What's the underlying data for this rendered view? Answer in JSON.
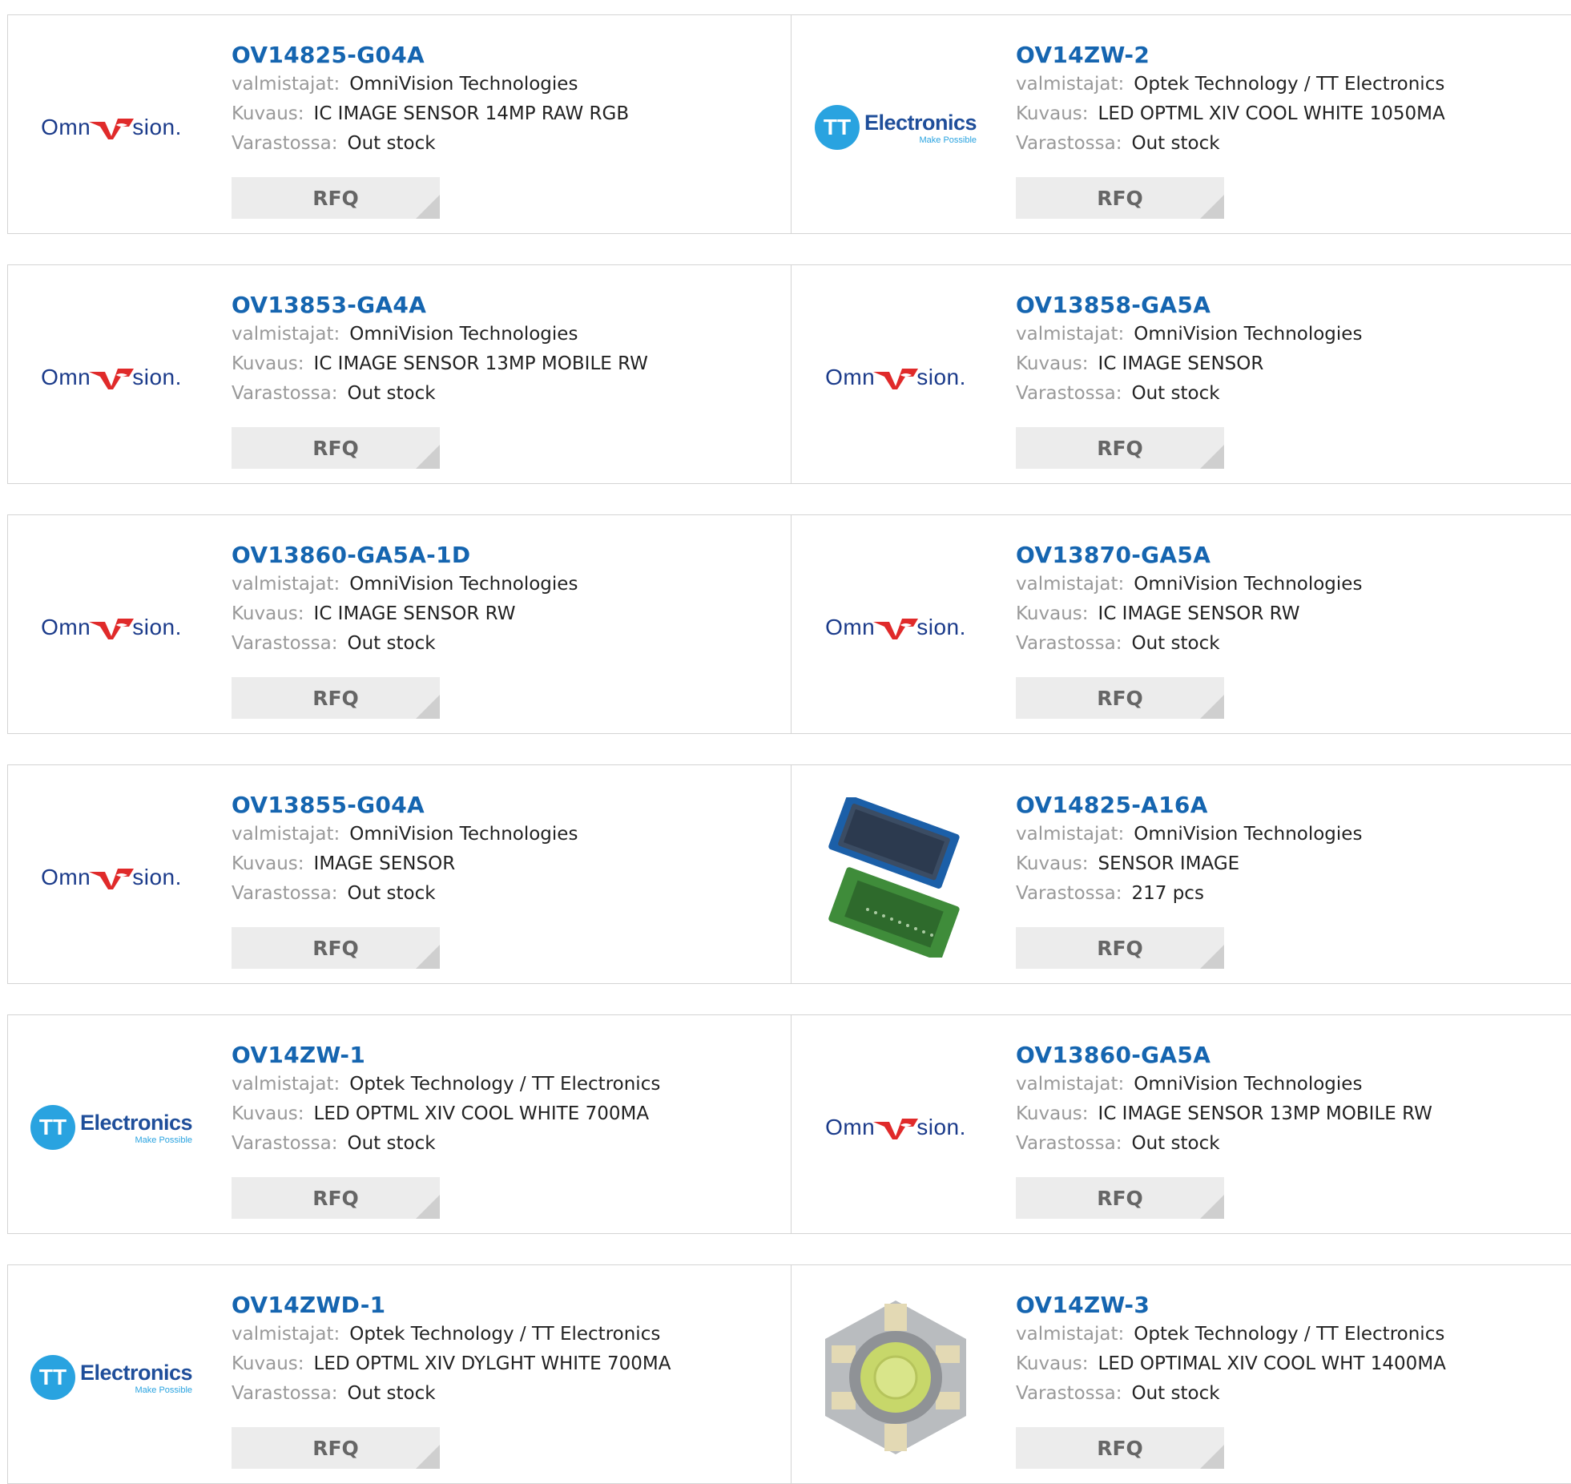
{
  "labels": {
    "manufacturer": "valmistajat:",
    "description": "Kuvaus:",
    "stock": "Varastossa:",
    "rfq": "RFQ"
  },
  "brands": {
    "omnivision": {
      "left": "Omn",
      "right": "sion.",
      "colors": {
        "text": "#1a3a8a",
        "mark": "#e02a2a"
      }
    },
    "tt": {
      "badge": "TT",
      "name": "Electronics",
      "tagline": "Make Possible",
      "colors": {
        "badge": "#29a3e0",
        "name": "#1f4e9a"
      }
    }
  },
  "accent_color": "#1565b0",
  "products": [
    {
      "part": "OV14825-G04A",
      "manufacturer": "OmniVision Technologies",
      "description": "IC IMAGE SENSOR 14MP RAW RGB",
      "stock": "Out stock",
      "image": "omnivision-logo"
    },
    {
      "part": "OV14ZW-2",
      "manufacturer": "Optek Technology / TT Electronics",
      "description": "LED OPTML XIV COOL WHITE 1050MA",
      "stock": "Out stock",
      "image": "tt-electronics-logo"
    },
    {
      "part": "OV13853-GA4A",
      "manufacturer": "OmniVision Technologies",
      "description": "IC IMAGE SENSOR 13MP MOBILE RW",
      "stock": "Out stock",
      "image": "omnivision-logo"
    },
    {
      "part": "OV13858-GA5A",
      "manufacturer": "OmniVision Technologies",
      "description": "IC IMAGE SENSOR",
      "stock": "Out stock",
      "image": "omnivision-logo"
    },
    {
      "part": "OV13860-GA5A-1D",
      "manufacturer": "OmniVision Technologies",
      "description": "IC IMAGE SENSOR RW",
      "stock": "Out stock",
      "image": "omnivision-logo"
    },
    {
      "part": "OV13870-GA5A",
      "manufacturer": "OmniVision Technologies",
      "description": "IC IMAGE SENSOR RW",
      "stock": "Out stock",
      "image": "omnivision-logo"
    },
    {
      "part": "OV13855-G04A",
      "manufacturer": "OmniVision Technologies",
      "description": "IMAGE SENSOR",
      "stock": "Out stock",
      "image": "omnivision-logo"
    },
    {
      "part": "OV14825-A16A",
      "manufacturer": "OmniVision Technologies",
      "description": "SENSOR IMAGE",
      "stock": "217 pcs",
      "image": "sensor-chip-photo"
    },
    {
      "part": "OV14ZW-1",
      "manufacturer": "Optek Technology / TT Electronics",
      "description": "LED OPTML XIV COOL WHITE 700MA",
      "stock": "Out stock",
      "image": "tt-electronics-logo"
    },
    {
      "part": "OV13860-GA5A",
      "manufacturer": "OmniVision Technologies",
      "description": "IC IMAGE SENSOR 13MP MOBILE RW",
      "stock": "Out stock",
      "image": "omnivision-logo"
    },
    {
      "part": "OV14ZWD-1",
      "manufacturer": "Optek Technology / TT Electronics",
      "description": "LED OPTML XIV DYLGHT WHITE 700MA",
      "stock": "Out stock",
      "image": "tt-electronics-logo"
    },
    {
      "part": "OV14ZW-3",
      "manufacturer": "Optek Technology / TT Electronics",
      "description": "LED OPTIMAL XIV COOL WHT 1400MA",
      "stock": "Out stock",
      "image": "led-star-photo"
    }
  ]
}
